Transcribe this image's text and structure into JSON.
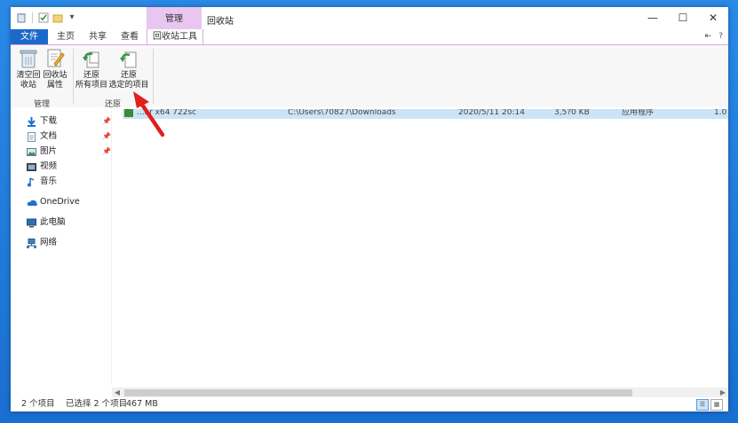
{
  "window": {
    "title": "回收站",
    "context_tab_header": "管理",
    "minimize": "—",
    "maximize": "☐",
    "close": "✕"
  },
  "tabs": {
    "file": "文件",
    "home": "主页",
    "share": "共享",
    "view": "查看",
    "recycle_tools": "回收站工具"
  },
  "ribbon": {
    "empty_recycle_bin": [
      "清空回",
      "收站"
    ],
    "recycle_bin_properties": [
      "回收站",
      "属性"
    ],
    "restore_all": [
      "还原",
      "所有项目"
    ],
    "restore_selected": [
      "还原",
      "选定的项目"
    ],
    "group_manage": "管理",
    "group_restore": "还原",
    "help": "?"
  },
  "nav": {
    "items": [
      {
        "label": "下载",
        "icon": "download-arrow-icon",
        "pinned": true
      },
      {
        "label": "文档",
        "icon": "document-icon",
        "pinned": true
      },
      {
        "label": "图片",
        "icon": "picture-icon",
        "pinned": true
      },
      {
        "label": "视频",
        "icon": "video-icon",
        "pinned": false
      },
      {
        "label": "音乐",
        "icon": "music-note-icon",
        "pinned": false
      },
      {
        "label": "OneDrive",
        "icon": "cloud-icon",
        "pinned": false
      },
      {
        "label": "此电脑",
        "icon": "computer-icon",
        "pinned": false
      },
      {
        "label": "网络",
        "icon": "network-icon",
        "pinned": false
      }
    ]
  },
  "file_row": {
    "name": "...ar x64 722sc",
    "location": "C:\\Users\\70827\\Downloads",
    "date": "2020/5/11 20:14",
    "size": "3,5?0 KB",
    "type": "应用程序",
    "tail": "1.0"
  },
  "status": {
    "count": "2 个项目",
    "selected": "已选择 2 个项目",
    "size": "467 MB"
  },
  "colors": {
    "accent": "#1b6ac9",
    "context_tab": "#e9c6ef",
    "selection": "#cce4f7",
    "annotation": "#e0201a"
  }
}
